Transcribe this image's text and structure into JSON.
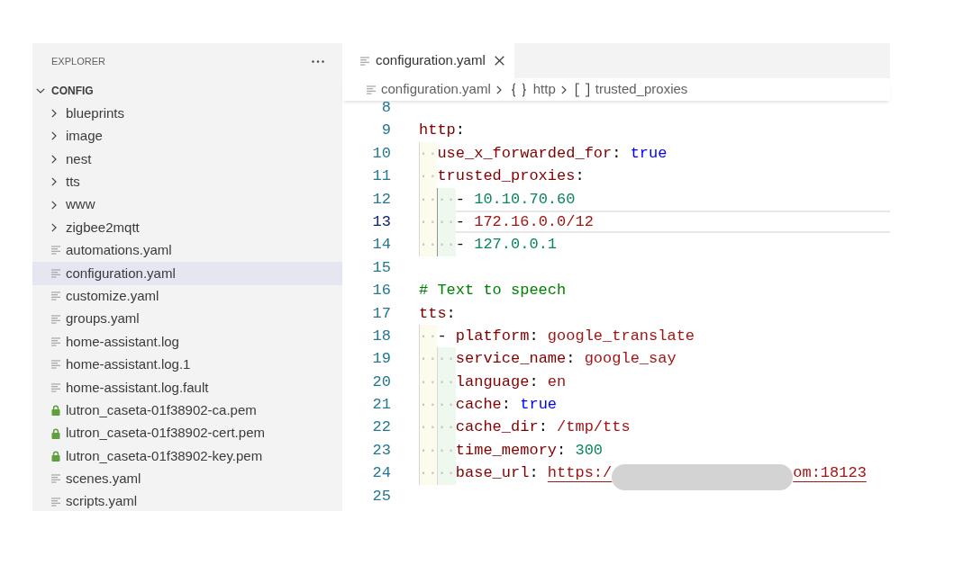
{
  "sidebar": {
    "title": "EXPLORER",
    "root": {
      "label": "CONFIG",
      "expanded": true,
      "children": [
        {
          "label": "blueprints",
          "kind": "folder",
          "expanded": false,
          "selected": false
        },
        {
          "label": "image",
          "kind": "folder",
          "expanded": false,
          "selected": false
        },
        {
          "label": "nest",
          "kind": "folder",
          "expanded": false,
          "selected": false
        },
        {
          "label": "tts",
          "kind": "folder",
          "expanded": false,
          "selected": false
        },
        {
          "label": "www",
          "kind": "folder",
          "expanded": false,
          "selected": false
        },
        {
          "label": "zigbee2mqtt",
          "kind": "folder",
          "expanded": false,
          "selected": false
        },
        {
          "label": "automations.yaml",
          "kind": "file",
          "selected": false
        },
        {
          "label": "configuration.yaml",
          "kind": "file",
          "selected": true
        },
        {
          "label": "customize.yaml",
          "kind": "file",
          "selected": false
        },
        {
          "label": "groups.yaml",
          "kind": "file",
          "selected": false
        },
        {
          "label": "home-assistant.log",
          "kind": "file",
          "selected": false
        },
        {
          "label": "home-assistant.log.1",
          "kind": "file",
          "selected": false
        },
        {
          "label": "home-assistant.log.fault",
          "kind": "file",
          "selected": false
        },
        {
          "label": "lutron_caseta-01f38902-ca.pem",
          "kind": "locked",
          "selected": false
        },
        {
          "label": "lutron_caseta-01f38902-cert.pem",
          "kind": "locked",
          "selected": false
        },
        {
          "label": "lutron_caseta-01f38902-key.pem",
          "kind": "locked",
          "selected": false
        },
        {
          "label": "scenes.yaml",
          "kind": "file",
          "selected": false
        },
        {
          "label": "scripts.yaml",
          "kind": "file",
          "selected": false
        }
      ]
    }
  },
  "editor": {
    "tabs": [
      {
        "label": "configuration.yaml",
        "selected": true
      }
    ],
    "breadcrumb": [
      {
        "label": "configuration.yaml",
        "kind": "file"
      },
      {
        "label": "http",
        "kind": "object"
      },
      {
        "label": "trusted_proxies",
        "kind": "array"
      }
    ],
    "lines": [
      {
        "number": "8",
        "current": false
      },
      {
        "number": "9",
        "current": false,
        "tokens": [
          {
            "kind": "key",
            "text": "http"
          },
          {
            "kind": "punct",
            "text": ":"
          }
        ]
      },
      {
        "number": "10",
        "current": false,
        "indent": {
          "text": "··",
          "active_guide": false
        },
        "tokens": [
          {
            "kind": "key",
            "text": "use_x_forwarded_for"
          },
          {
            "kind": "punct",
            "text": ": "
          },
          {
            "kind": "bool",
            "text": "true"
          }
        ]
      },
      {
        "number": "11",
        "current": false,
        "indent": {
          "text": "··",
          "active_guide": false
        },
        "tokens": [
          {
            "kind": "key",
            "text": "trusted_proxies"
          },
          {
            "kind": "punct",
            "text": ":"
          }
        ]
      },
      {
        "number": "12",
        "current": false,
        "indent": {
          "text": "····",
          "active_guide": true
        },
        "tokens": [
          {
            "kind": "punct",
            "text": "- "
          },
          {
            "kind": "number",
            "text": "10.10.70.60"
          }
        ]
      },
      {
        "number": "13",
        "current": true,
        "indent": {
          "text": "····",
          "active_guide": true
        },
        "tokens": [
          {
            "kind": "punct",
            "text": "- "
          },
          {
            "kind": "string",
            "text": "172.16.0.0/12"
          }
        ]
      },
      {
        "number": "14",
        "current": false,
        "indent": {
          "text": "····",
          "active_guide": true
        },
        "tokens": [
          {
            "kind": "punct",
            "text": "- "
          },
          {
            "kind": "number",
            "text": "127.0.0.1"
          }
        ]
      },
      {
        "number": "15",
        "current": false
      },
      {
        "number": "16",
        "current": false,
        "tokens": [
          {
            "kind": "comment",
            "text": "# Text to speech"
          }
        ]
      },
      {
        "number": "17",
        "current": false,
        "tokens": [
          {
            "kind": "key",
            "text": "tts"
          },
          {
            "kind": "punct",
            "text": ":"
          }
        ]
      },
      {
        "number": "18",
        "current": false,
        "indent": {
          "text": "··",
          "active_guide": false
        },
        "tokens": [
          {
            "kind": "punct",
            "text": "- "
          },
          {
            "kind": "key",
            "text": "platform"
          },
          {
            "kind": "punct",
            "text": ": "
          },
          {
            "kind": "string",
            "text": "google_translate"
          }
        ]
      },
      {
        "number": "19",
        "current": false,
        "indent": {
          "text": "····",
          "active_guide": false
        },
        "tokens": [
          {
            "kind": "key",
            "text": "service_name"
          },
          {
            "kind": "punct",
            "text": ": "
          },
          {
            "kind": "string",
            "text": "google_say"
          }
        ]
      },
      {
        "number": "20",
        "current": false,
        "indent": {
          "text": "····",
          "active_guide": false
        },
        "tokens": [
          {
            "kind": "key",
            "text": "language"
          },
          {
            "kind": "punct",
            "text": ": "
          },
          {
            "kind": "string",
            "text": "en"
          }
        ]
      },
      {
        "number": "21",
        "current": false,
        "indent": {
          "text": "····",
          "active_guide": false
        },
        "tokens": [
          {
            "kind": "key",
            "text": "cache"
          },
          {
            "kind": "punct",
            "text": ": "
          },
          {
            "kind": "bool",
            "text": "true"
          }
        ]
      },
      {
        "number": "22",
        "current": false,
        "indent": {
          "text": "····",
          "active_guide": false
        },
        "tokens": [
          {
            "kind": "key",
            "text": "cache_dir"
          },
          {
            "kind": "punct",
            "text": ": "
          },
          {
            "kind": "string",
            "text": "/tmp/tts"
          }
        ]
      },
      {
        "number": "23",
        "current": false,
        "indent": {
          "text": "····",
          "active_guide": false
        },
        "tokens": [
          {
            "kind": "key",
            "text": "time_memory"
          },
          {
            "kind": "punct",
            "text": ": "
          },
          {
            "kind": "number",
            "text": "300"
          }
        ]
      },
      {
        "number": "24",
        "current": false,
        "indent": {
          "text": "····",
          "active_guide": false
        },
        "tokens": [
          {
            "kind": "key",
            "text": "base_url"
          },
          {
            "kind": "punct",
            "text": ": "
          },
          {
            "kind": "link",
            "text": "https:/"
          },
          {
            "kind": "redacted"
          },
          {
            "kind": "link",
            "text": "om:18123"
          }
        ]
      },
      {
        "number": "25",
        "current": false
      }
    ]
  }
}
